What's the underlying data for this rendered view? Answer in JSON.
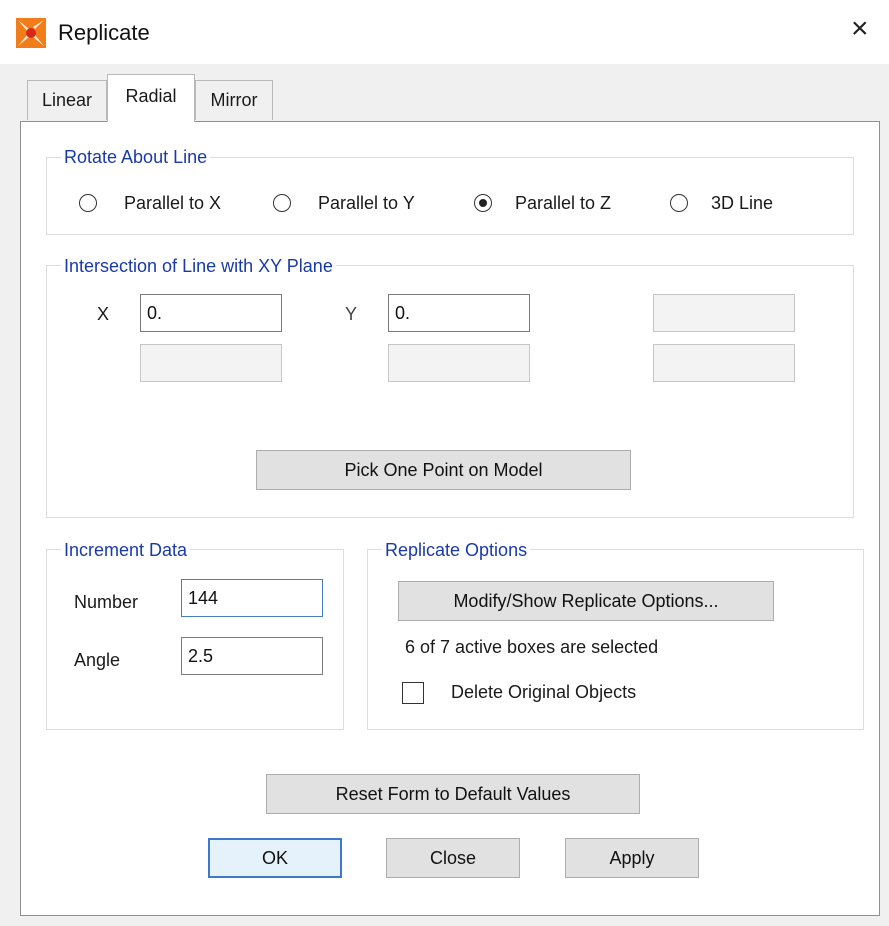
{
  "window": {
    "title": "Replicate",
    "close_glyph": "×",
    "icon": "replicate-app-icon"
  },
  "tabs": [
    {
      "label": "Linear",
      "active": false
    },
    {
      "label": "Radial",
      "active": true
    },
    {
      "label": "Mirror",
      "active": false
    }
  ],
  "rotate_about_line": {
    "label": "Rotate About Line",
    "options": [
      {
        "label": "Parallel to X",
        "selected": false
      },
      {
        "label": "Parallel to Y",
        "selected": false
      },
      {
        "label": "Parallel to Z",
        "selected": true
      },
      {
        "label": "3D Line",
        "selected": false
      }
    ]
  },
  "intersection": {
    "label": "Intersection of Line with XY Plane",
    "x_label": "X",
    "x_value": "0.",
    "y_label": "Y",
    "y_value": "0.",
    "pick_button": "Pick One Point on Model"
  },
  "increment_data": {
    "label": "Increment Data",
    "number_label": "Number",
    "number_value": "144",
    "angle_label": "Angle",
    "angle_value": "2.5"
  },
  "replicate_options": {
    "label": "Replicate Options",
    "modify_button": "Modify/Show Replicate Options...",
    "status": "6 of 7 active boxes are selected",
    "delete_label": "Delete Original Objects",
    "delete_checked": false
  },
  "buttons": {
    "reset": "Reset Form to Default Values",
    "ok": "OK",
    "close": "Close",
    "apply": "Apply"
  },
  "colors": {
    "group_label": "#1a3aa8",
    "default_button_border": "#3c79c8",
    "icon_orange": "#f07d1a",
    "icon_red": "#d8281e"
  }
}
